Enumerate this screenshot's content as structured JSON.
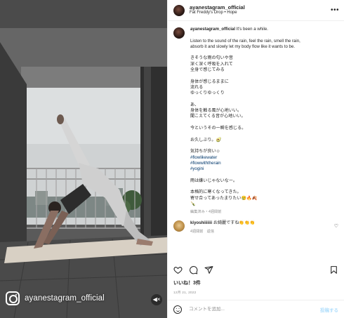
{
  "reel": {
    "username": "ayanestagram_official"
  },
  "header": {
    "username": "ayanestagram_official",
    "track": "Fat Freddy's Drop • Hope"
  },
  "caption": {
    "username": "ayanestagram_official",
    "first_line": "It's been a while.",
    "lines": [
      "",
      "Listen to the sound of the rain, feel the rain, smell the rain,",
      "absorb it and slowly let my body flow like it wants to be.",
      "",
      "きそうな雨の匂いや音",
      "深く深く呼吸を入れて",
      "全身で感じてみる",
      "",
      "身体が感じるままに",
      "流れる",
      "ゆっくりゆっくり",
      "",
      "あ、",
      "身体を触る風が心地いい。",
      "聞こえてくる音が心地いい。",
      "",
      "今というその一瞬を感じる。",
      "",
      "お久しぶり。🥑",
      "",
      "気持ちが良い☺",
      "#flowlikewater",
      "#flowwiththerain",
      "#yogini",
      "",
      "雨は嫌いじゃないなー。",
      "",
      "本格的に寒くなってきた。",
      "寄せ合ってあったまりたい😢🔥🍂",
      "🍾"
    ],
    "meta": "編集済み・4週間前"
  },
  "comment": {
    "username": "kiyoshiiiiiii",
    "text": "お綺麗ですね👏👏👏",
    "meta": "4週間前　返信"
  },
  "likes": "いいね！3件",
  "date": "12月 21, 2022",
  "comment_box": {
    "placeholder": "コメントを追加...",
    "post_label": "投稿する"
  }
}
